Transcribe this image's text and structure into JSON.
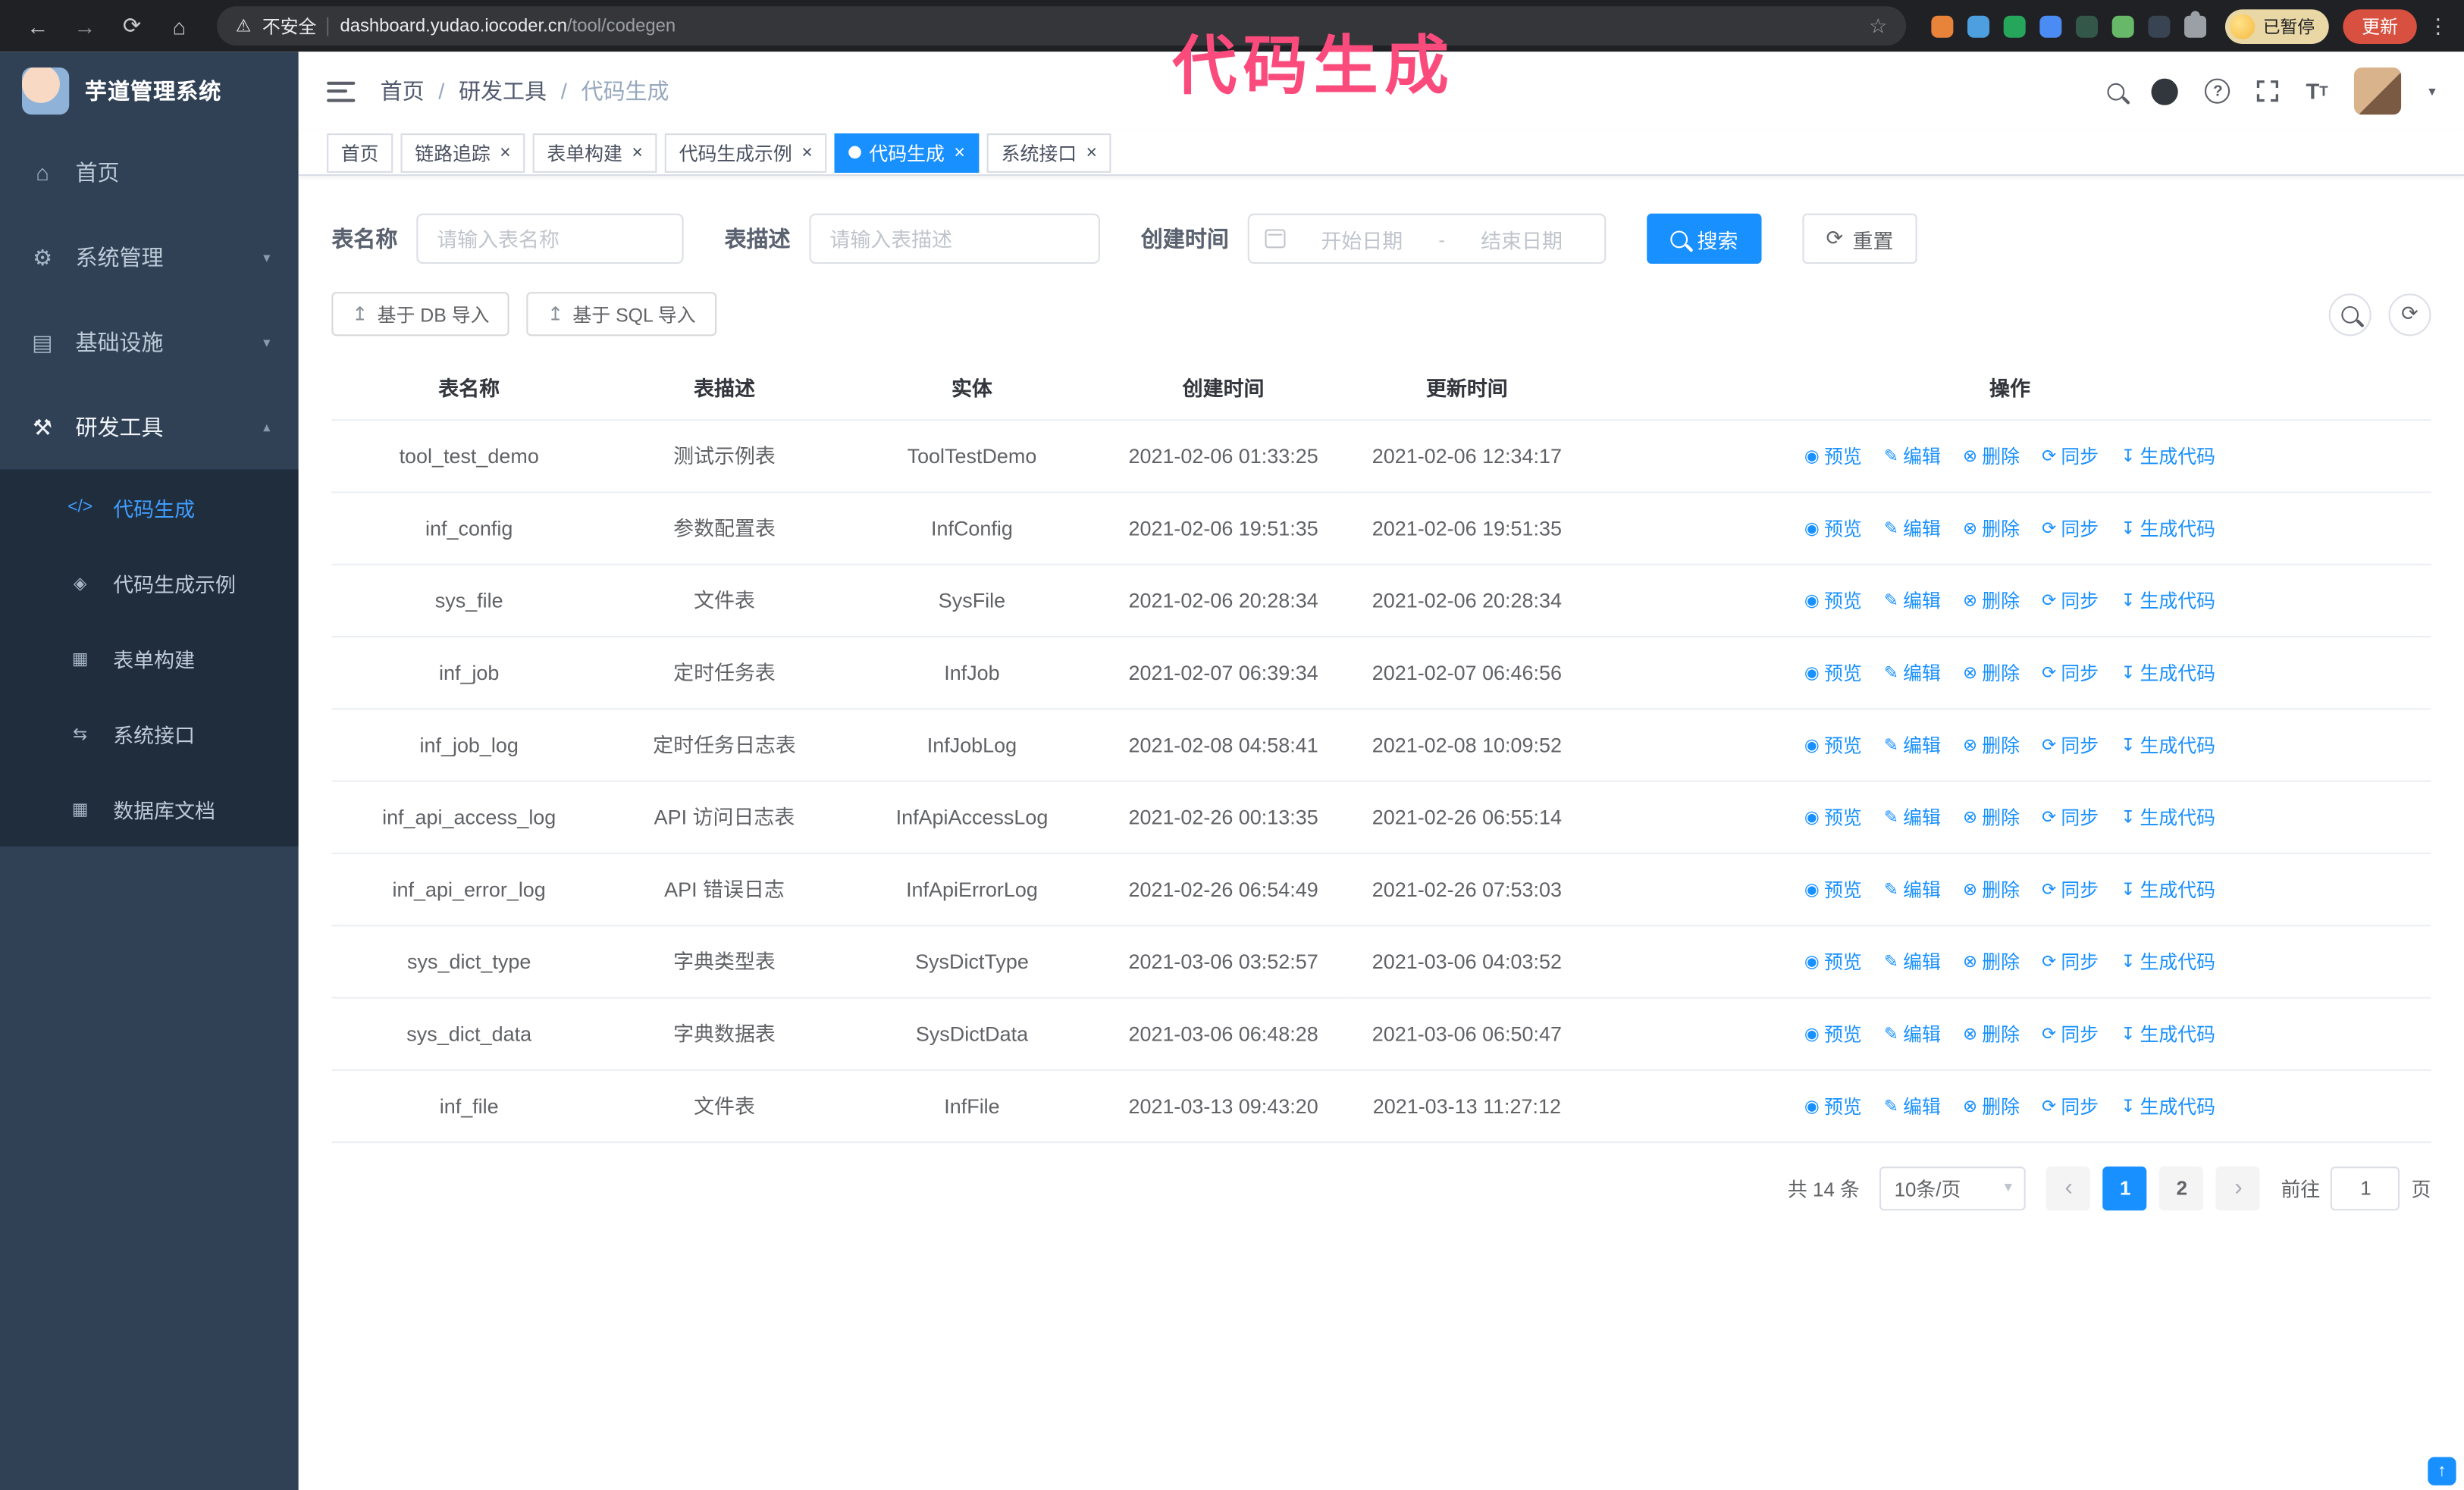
{
  "icons": {
    "back": "←",
    "forward": "→",
    "reload": "⟳",
    "home": "⌂",
    "warning": "⚠",
    "star": "☆",
    "browser_menu": "⋮",
    "close": "×",
    "caret_down": "▾",
    "prev": "‹",
    "next": "›",
    "reset": "⟳",
    "sync_tool": "⟳",
    "upload": "↥",
    "back_to_top": "↑"
  },
  "browser": {
    "security_label": "不安全",
    "url_host": "dashboard.yudao.iocoder.cn",
    "url_path": "/tool/codegen",
    "extensions": [
      {
        "name": "extension-fox",
        "color": "#e8833a"
      },
      {
        "name": "extension-drop",
        "color": "#4d9fe0"
      },
      {
        "name": "extension-check",
        "color": "#26a65b"
      },
      {
        "name": "extension-people",
        "color": "#4b8bf4"
      },
      {
        "name": "extension-dark-green",
        "color": "#33584a"
      },
      {
        "name": "extension-leaf",
        "color": "#67b868"
      },
      {
        "name": "extension-pin",
        "color": "#394452"
      }
    ],
    "paused_badge": "已暂停",
    "update_button": "更新"
  },
  "annotation": "代码生成",
  "sidebar": {
    "app_title": "芋道管理系统",
    "items": [
      {
        "icon": "⌂",
        "label": "首页"
      },
      {
        "icon": "⚙",
        "label": "系统管理",
        "chevron": "▾"
      },
      {
        "icon": "▤",
        "label": "基础设施",
        "chevron": "▾"
      },
      {
        "icon": "⚒",
        "label": "研发工具",
        "chevron": "▴",
        "active": true
      }
    ],
    "sub_items": [
      {
        "icon": "</>",
        "label": "代码生成",
        "active": true
      },
      {
        "icon": "◈",
        "label": "代码生成示例"
      },
      {
        "icon": "▦",
        "label": "表单构建"
      },
      {
        "icon": "⇆",
        "label": "系统接口"
      },
      {
        "icon": "▦",
        "label": "数据库文档"
      }
    ]
  },
  "breadcrumb": {
    "sep": "/",
    "items": [
      {
        "label": "首页"
      },
      {
        "label": "研发工具"
      },
      {
        "label": "代码生成"
      }
    ]
  },
  "tabs": [
    {
      "label": "首页"
    },
    {
      "label": "链路追踪",
      "closable": true
    },
    {
      "label": "表单构建",
      "closable": true
    },
    {
      "label": "代码生成示例",
      "closable": true
    },
    {
      "label": "代码生成",
      "closable": true,
      "active": true
    },
    {
      "label": "系统接口",
      "closable": true
    }
  ],
  "filters": {
    "table_name_label": "表名称",
    "table_name_placeholder": "请输入表名称",
    "table_desc_label": "表描述",
    "table_desc_placeholder": "请输入表描述",
    "create_time_label": "创建时间",
    "date_start_placeholder": "开始日期",
    "date_separator": "-",
    "date_end_placeholder": "结束日期",
    "search_button": "搜索",
    "reset_button": "重置"
  },
  "toolbar": {
    "import_db_button": "基于 DB 导入",
    "import_sql_button": "基于 SQL 导入"
  },
  "table": {
    "headers": [
      "表名称",
      "表描述",
      "实体",
      "创建时间",
      "更新时间",
      "操作"
    ],
    "actions": [
      {
        "icon": "◉",
        "label": "预览"
      },
      {
        "icon": "✎",
        "label": "编辑"
      },
      {
        "icon": "⊗",
        "label": "删除"
      },
      {
        "icon": "⟳",
        "label": "同步"
      },
      {
        "icon": "↧",
        "label": "生成代码"
      }
    ],
    "rows": [
      {
        "name": "tool_test_demo",
        "desc": "测试示例表",
        "entity": "ToolTestDemo",
        "created": "2021-02-06 01:33:25",
        "updated": "2021-02-06 12:34:17"
      },
      {
        "name": "inf_config",
        "desc": "参数配置表",
        "entity": "InfConfig",
        "created": "2021-02-06 19:51:35",
        "updated": "2021-02-06 19:51:35"
      },
      {
        "name": "sys_file",
        "desc": "文件表",
        "entity": "SysFile",
        "created": "2021-02-06 20:28:34",
        "updated": "2021-02-06 20:28:34"
      },
      {
        "name": "inf_job",
        "desc": "定时任务表",
        "entity": "InfJob",
        "created": "2021-02-07 06:39:34",
        "updated": "2021-02-07 06:46:56"
      },
      {
        "name": "inf_job_log",
        "desc": "定时任务日志表",
        "entity": "InfJobLog",
        "created": "2021-02-08 04:58:41",
        "updated": "2021-02-08 10:09:52"
      },
      {
        "name": "inf_api_access_log",
        "desc": "API 访问日志表",
        "entity": "InfApiAccessLog",
        "created": "2021-02-26 00:13:35",
        "updated": "2021-02-26 06:55:14"
      },
      {
        "name": "inf_api_error_log",
        "desc": "API 错误日志",
        "entity": "InfApiErrorLog",
        "created": "2021-02-26 06:54:49",
        "updated": "2021-02-26 07:53:03"
      },
      {
        "name": "sys_dict_type",
        "desc": "字典类型表",
        "entity": "SysDictType",
        "created": "2021-03-06 03:52:57",
        "updated": "2021-03-06 04:03:52"
      },
      {
        "name": "sys_dict_data",
        "desc": "字典数据表",
        "entity": "SysDictData",
        "created": "2021-03-06 06:48:28",
        "updated": "2021-03-06 06:50:47"
      },
      {
        "name": "inf_file",
        "desc": "文件表",
        "entity": "InfFile",
        "created": "2021-03-13 09:43:20",
        "updated": "2021-03-13 11:27:12"
      }
    ]
  },
  "pagination": {
    "total_label": "共 14 条",
    "page_size": "10条/页",
    "pages": [
      {
        "label": "1",
        "active": true
      },
      {
        "label": "2"
      }
    ],
    "goto_label": "前往",
    "goto_value": "1",
    "goto_unit": "页"
  }
}
